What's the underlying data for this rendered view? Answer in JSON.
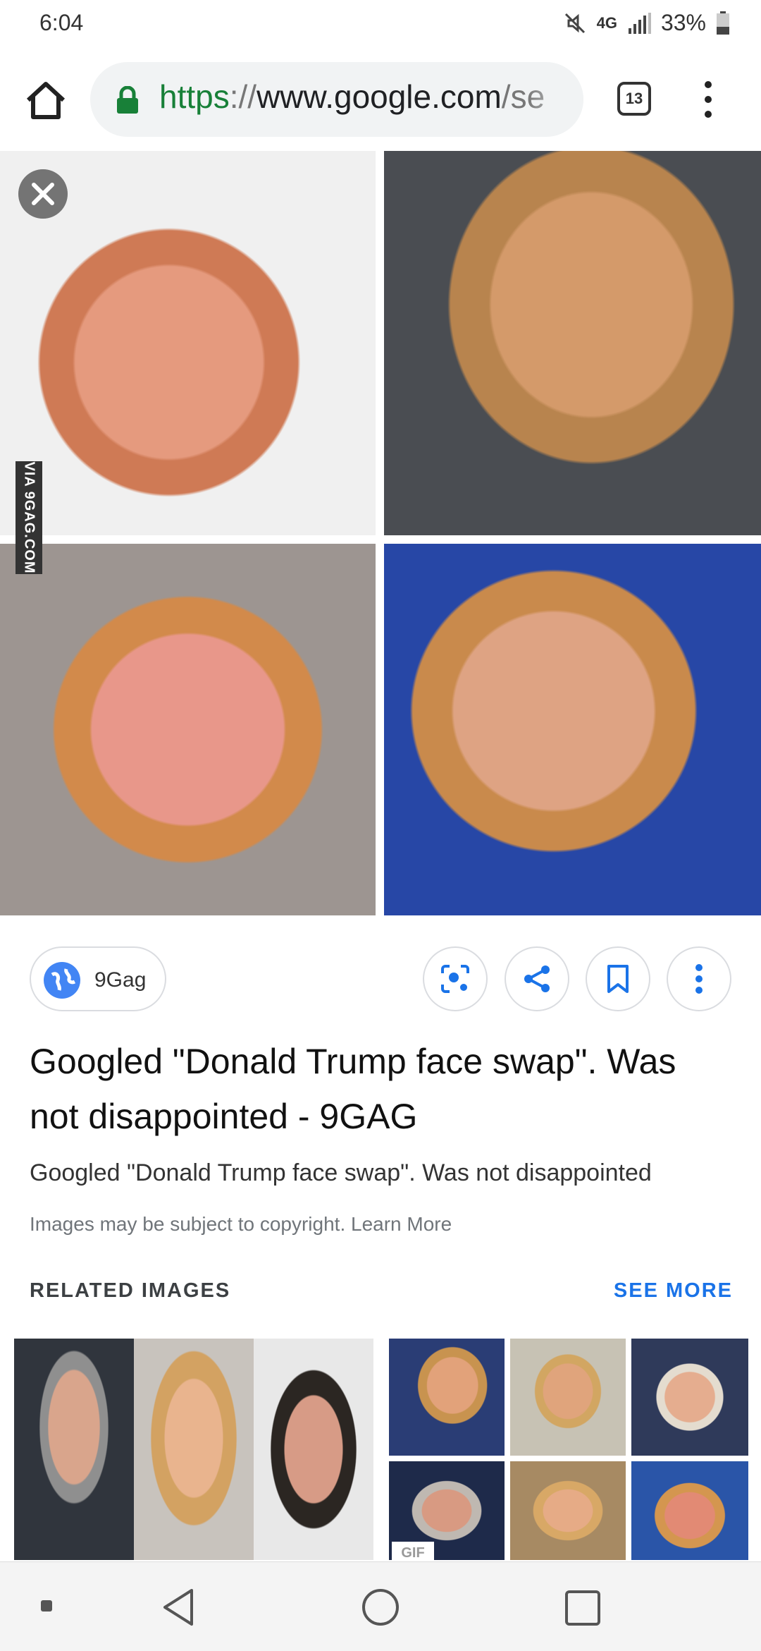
{
  "status_bar": {
    "time": "6:04",
    "network": "4G",
    "battery": "33%"
  },
  "browser": {
    "url_scheme": "https",
    "url_separator": "://",
    "url_host": "www.google.com",
    "url_path": "/se",
    "tab_count": "13",
    "icons": [
      "home-icon",
      "lock-icon",
      "tabs-icon",
      "overflow-menu-icon"
    ]
  },
  "image_viewer": {
    "watermark": "VIA 9GAG.COM",
    "close_icon": "close-icon"
  },
  "result": {
    "source_label": "9Gag",
    "title": "Googled \"Donald Trump face swap\". Was not disappointed - 9GAG",
    "description": "Googled \"Donald Trump face swap\". Was not disappointed",
    "copyright_prefix": "Images may be subject to copyright. ",
    "learn_more": "Learn More",
    "actions": [
      "lens-icon",
      "share-icon",
      "bookmark-icon",
      "more-icon"
    ]
  },
  "related": {
    "heading": "RELATED IMAGES",
    "see_more": "SEE MORE",
    "badge": "GIF"
  },
  "nav": {
    "icons": [
      "recent-dot-icon",
      "back-icon",
      "home-circle-icon",
      "overview-square-icon"
    ]
  },
  "colors": {
    "accent": "#1a73e8",
    "secure_green": "#188038"
  }
}
